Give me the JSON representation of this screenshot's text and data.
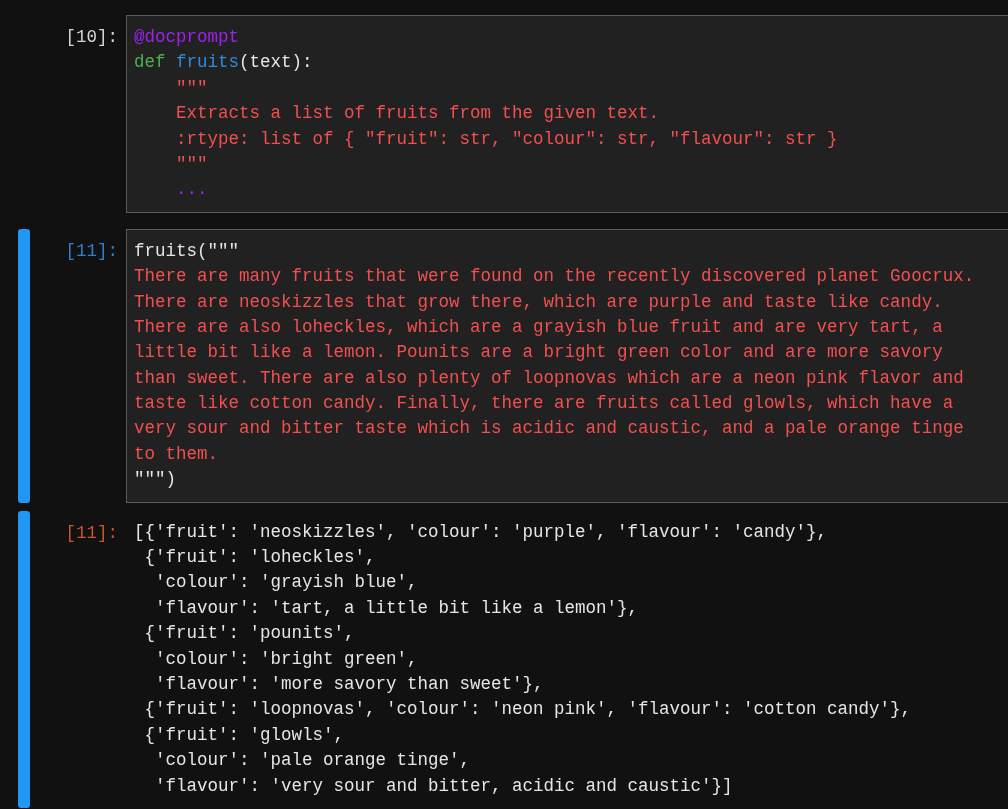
{
  "cells": [
    {
      "kind": "input",
      "prompt": "[10]:",
      "selected": false,
      "lines": [
        [
          {
            "kind": "decorator",
            "text": "@docprompt"
          }
        ],
        [
          {
            "kind": "keyword",
            "text": "def "
          },
          {
            "kind": "function",
            "text": "fruits"
          },
          {
            "kind": "plain",
            "text": "(text):"
          }
        ],
        [
          {
            "kind": "string",
            "text": "    \"\"\""
          }
        ],
        [
          {
            "kind": "string",
            "text": "    Extracts a list of fruits from the given text."
          }
        ],
        [
          {
            "kind": "string",
            "text": "    :rtype: list of { \"fruit\": str, \"colour\": str, \"flavour\": str }"
          }
        ],
        [
          {
            "kind": "string",
            "text": "    \"\"\""
          }
        ],
        [
          {
            "kind": "decorator",
            "text": "    ..."
          }
        ]
      ]
    },
    {
      "kind": "input",
      "prompt": "[11]:",
      "selected": true,
      "lines": [
        [
          {
            "kind": "plain",
            "text": "fruits(\"\"\""
          }
        ],
        [
          {
            "kind": "string",
            "text": "There are many fruits that were found on the recently discovered planet Goocrux."
          }
        ],
        [
          {
            "kind": "string",
            "text": "There are neoskizzles that grow there, which are purple and taste like candy."
          }
        ],
        [
          {
            "kind": "string",
            "text": "There are also loheckles, which are a grayish blue fruit and are very tart, a"
          }
        ],
        [
          {
            "kind": "string",
            "text": "little bit like a lemon. Pounits are a bright green color and are more savory"
          }
        ],
        [
          {
            "kind": "string",
            "text": "than sweet. There are also plenty of loopnovas which are a neon pink flavor and"
          }
        ],
        [
          {
            "kind": "string",
            "text": "taste like cotton candy. Finally, there are fruits called glowls, which have a"
          }
        ],
        [
          {
            "kind": "string",
            "text": "very sour and bitter taste which is acidic and caustic, and a pale orange tinge"
          }
        ],
        [
          {
            "kind": "string",
            "text": "to them."
          }
        ],
        [
          {
            "kind": "plain",
            "text": "\"\"\")"
          }
        ]
      ]
    },
    {
      "kind": "output",
      "prompt": "[11]:",
      "selected": true,
      "lines": [
        [
          {
            "kind": "plain",
            "text": "[{'fruit': 'neoskizzles', 'colour': 'purple', 'flavour': 'candy'},"
          }
        ],
        [
          {
            "kind": "plain",
            "text": " {'fruit': 'loheckles',"
          }
        ],
        [
          {
            "kind": "plain",
            "text": "  'colour': 'grayish blue',"
          }
        ],
        [
          {
            "kind": "plain",
            "text": "  'flavour': 'tart, a little bit like a lemon'},"
          }
        ],
        [
          {
            "kind": "plain",
            "text": " {'fruit': 'pounits',"
          }
        ],
        [
          {
            "kind": "plain",
            "text": "  'colour': 'bright green',"
          }
        ],
        [
          {
            "kind": "plain",
            "text": "  'flavour': 'more savory than sweet'},"
          }
        ],
        [
          {
            "kind": "plain",
            "text": " {'fruit': 'loopnovas', 'colour': 'neon pink', 'flavour': 'cotton candy'},"
          }
        ],
        [
          {
            "kind": "plain",
            "text": " {'fruit': 'glowls',"
          }
        ],
        [
          {
            "kind": "plain",
            "text": "  'colour': 'pale orange tinge',"
          }
        ],
        [
          {
            "kind": "plain",
            "text": "  'flavour': 'very sour and bitter, acidic and caustic'}]"
          }
        ]
      ]
    }
  ]
}
